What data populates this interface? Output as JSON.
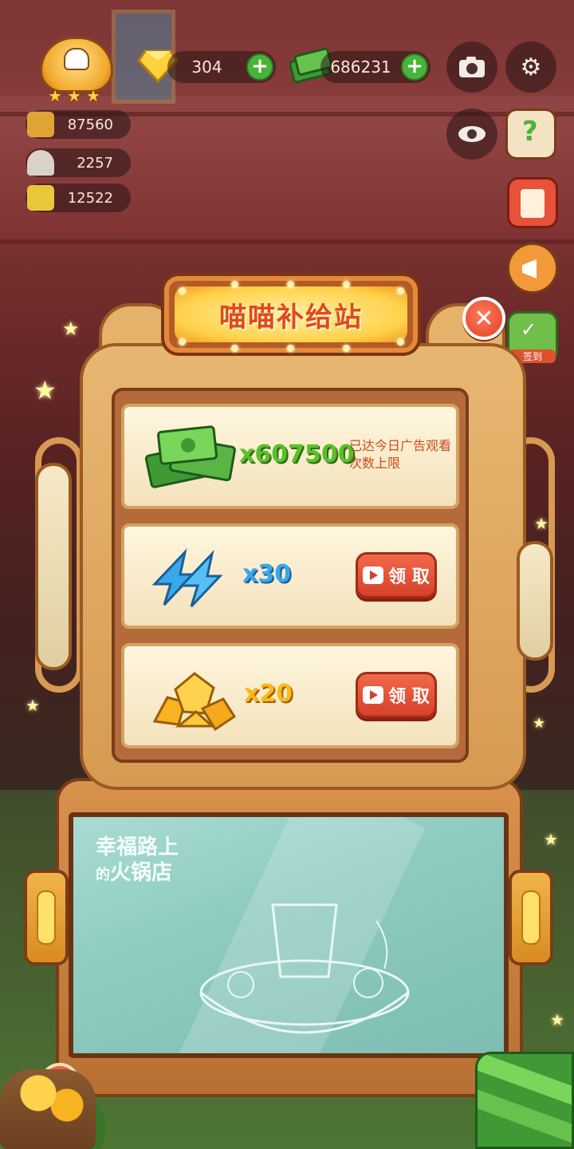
{
  "hud": {
    "gems": "304",
    "cash": "686231",
    "stats": [
      {
        "icon": "pot-icon",
        "value": "87560"
      },
      {
        "icon": "cloche-icon",
        "value": "2257"
      },
      {
        "icon": "ticket-icon",
        "value": "12522"
      }
    ],
    "buttons": [
      "camera-icon",
      "gear-icon",
      "eye-icon",
      "help-book-icon",
      "recipe-icon",
      "megaphone-icon"
    ],
    "checkin_label": "签到"
  },
  "panel": {
    "title": "喵喵补给站",
    "rewards": [
      {
        "icon": "cash-stack-icon",
        "amount": "x607500",
        "note": "已达今日广告观看次数上限"
      },
      {
        "icon": "lightning-icon",
        "amount": "x30",
        "button": "领 取"
      },
      {
        "icon": "gold-gems-icon",
        "amount": "x20",
        "button": "领 取"
      }
    ]
  },
  "board": {
    "line1": "幸福路上",
    "line2_small": "的",
    "line2": "火锅店"
  },
  "colors": {
    "title_text": "#e0491f",
    "cash_amount": "#58c12a",
    "energy_amount": "#3aa7ea",
    "gem_amount": "#ffb818",
    "claim_button": "#e0502f",
    "note_text": "#cc4b1e"
  }
}
